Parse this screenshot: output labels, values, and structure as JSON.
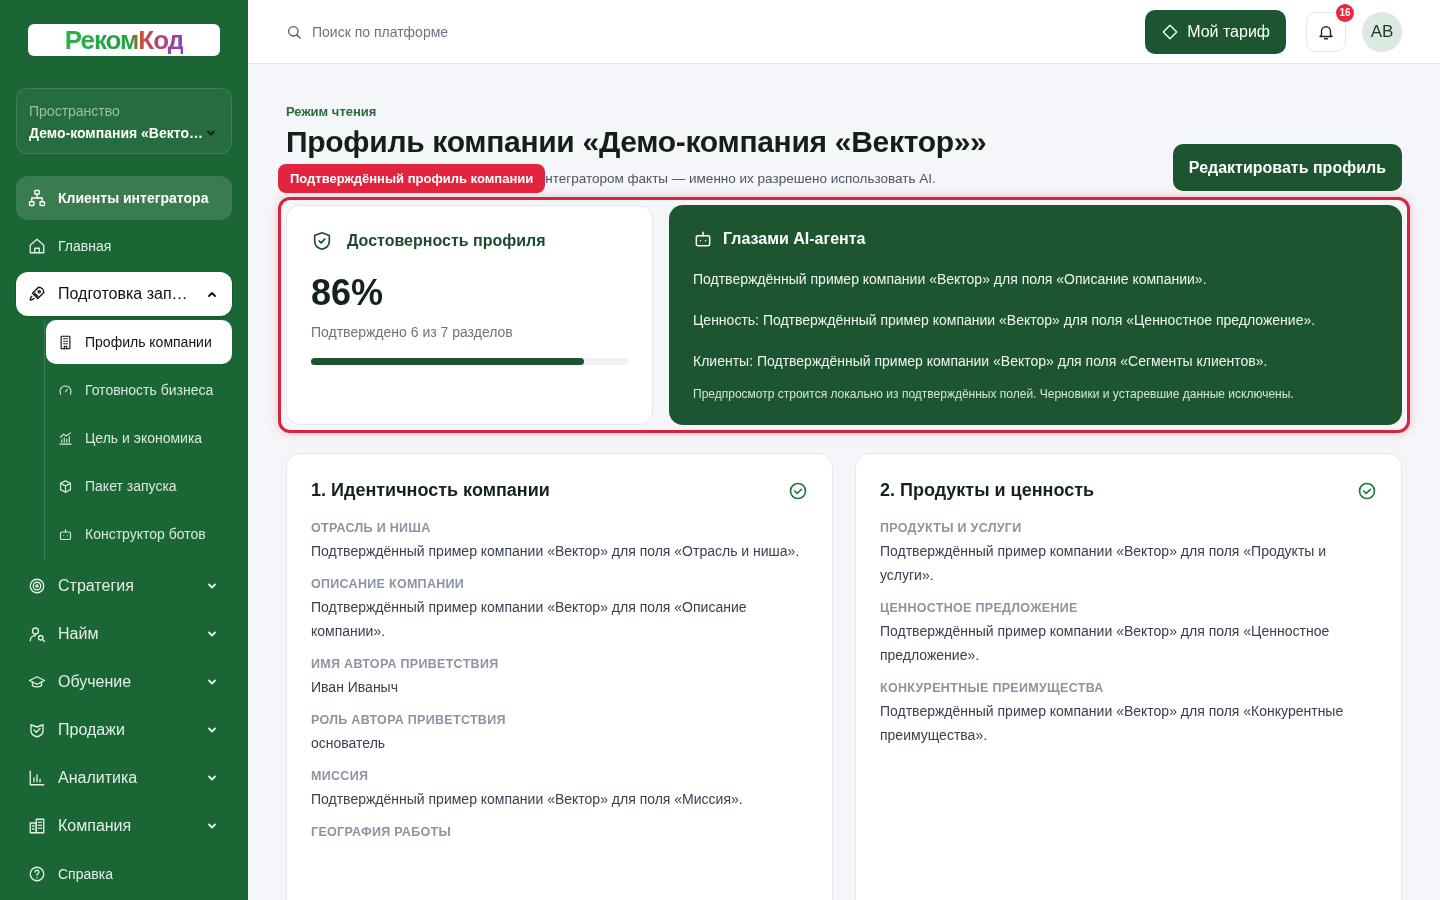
{
  "sidebar": {
    "logo": "РекомКод",
    "workspace": {
      "label": "Пространство",
      "value": "Демо-компания «Векто…"
    },
    "nav_items": [
      {
        "kind": "featured",
        "label": "Клиенты интегратора"
      },
      {
        "kind": "link",
        "label": "Главная"
      },
      {
        "kind": "group",
        "label": "Подготовка зап…",
        "selected": true,
        "expanded": true,
        "children": [
          {
            "label": "Профиль компании",
            "selected": true
          },
          {
            "label": "Готовность бизнеса",
            "selected": false
          },
          {
            "label": "Цель и экономика",
            "selected": false
          },
          {
            "label": "Пакет запуска",
            "selected": false
          },
          {
            "label": "Конструктор ботов",
            "selected": false
          }
        ]
      },
      {
        "kind": "group",
        "label": "Стратегия",
        "selected": false,
        "expanded": false
      },
      {
        "kind": "group",
        "label": "Найм",
        "selected": false,
        "expanded": false
      },
      {
        "kind": "group",
        "label": "Обучение",
        "selected": false,
        "expanded": false
      },
      {
        "kind": "group",
        "label": "Продажи",
        "selected": false,
        "expanded": false
      },
      {
        "kind": "group",
        "label": "Аналитика",
        "selected": false,
        "expanded": false
      },
      {
        "kind": "group",
        "label": "Компания",
        "selected": false,
        "expanded": false
      },
      {
        "kind": "link",
        "label": "Справка"
      }
    ]
  },
  "topbar": {
    "search": {
      "placeholder": "Поиск по платформе"
    },
    "plan_button": "Мой тариф",
    "notifications": "16",
    "avatar": "AB"
  },
  "header": {
    "mode": "Режим чтения",
    "title": "Профиль компании «Демо-компания «Вектор»»",
    "badge": "Подтверждённый профиль компании",
    "subtitle": "нтегратором факты — именно их разрешено использовать AI.",
    "edit_button": "Редактировать профиль"
  },
  "reliability": {
    "title": "Достоверность профиля",
    "value": "86%",
    "caption": "Подтверждено 6 из 7 разделов",
    "level": 0.86
  },
  "ai_preview": {
    "title": "Глазами AI-агента",
    "lines": [
      "Подтверждённый пример компании «Вектор» для поля «Описание компании».",
      "Ценность: Подтверждённый пример компании «Вектор» для поля «Ценностное предложение».",
      "Клиенты: Подтверждённый пример компании «Вектор» для поля «Сегменты клиентов»."
    ],
    "note": "Предпросмотр строится локально из подтверждённых полей. Черновики и устаревшие данные исключены."
  },
  "sections": [
    {
      "title": "1. Идентичность компании",
      "verified": true,
      "fields": [
        {
          "label": "ОТРАСЛЬ И НИША",
          "value": "Подтверждённый пример компании «Вектор» для поля «Отрасль и ниша»."
        },
        {
          "label": "ОПИСАНИЕ КОМПАНИИ",
          "value": "Подтверждённый пример компании «Вектор» для поля «Описание компании»."
        },
        {
          "label": "ИМЯ АВТОРА ПРИВЕТСТВИЯ",
          "value": "Иван Иваныч"
        },
        {
          "label": "РОЛЬ АВТОРА ПРИВЕТСТВИЯ",
          "value": "основатель"
        },
        {
          "label": "МИССИЯ",
          "value": "Подтверждённый пример компании «Вектор» для поля «Миссия»."
        },
        {
          "label": "ГЕОГРАФИЯ РАБОТЫ"
        }
      ]
    },
    {
      "title": "2. Продукты и ценность",
      "verified": true,
      "fields": [
        {
          "label": "ПРОДУКТЫ И УСЛУГИ",
          "value": "Подтверждённый пример компании «Вектор» для поля «Продукты и услуги»."
        },
        {
          "label": "ЦЕННОСТНОЕ ПРЕДЛОЖЕНИЕ",
          "value": "Подтверждённый пример компании «Вектор» для поля «Ценностное предложение»."
        },
        {
          "label": "КОНКУРЕНТНЫЕ ПРЕИМУЩЕСТВА",
          "value": "Подтверждённый пример компании «Вектор» для поля «Конкурентные преимущества»."
        }
      ]
    }
  ]
}
